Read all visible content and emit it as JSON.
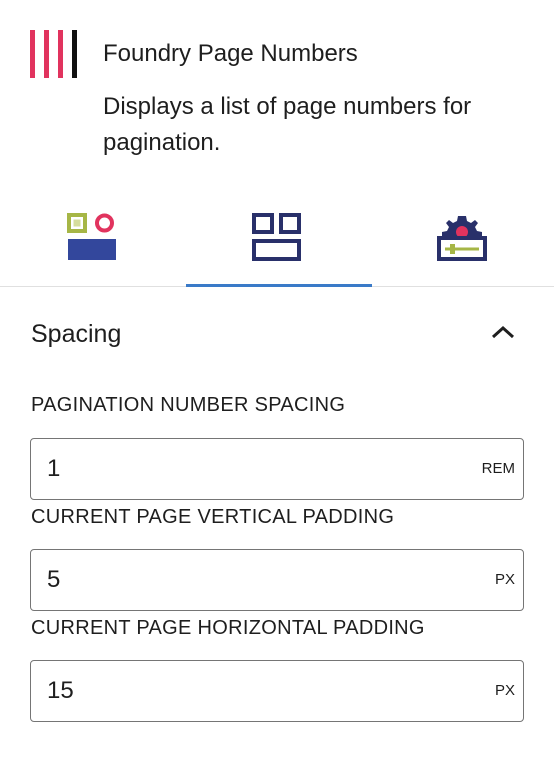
{
  "block": {
    "title": "Foundry Page Numbers",
    "description": "Displays a list of page numbers for pagination.",
    "icon": "pagination-bars-icon",
    "icon_colors": [
      "#e1335e",
      "#e1335e",
      "#e1335e",
      "#111111"
    ]
  },
  "tabs": [
    {
      "name": "styles",
      "icon": "styles-icon",
      "active": false
    },
    {
      "name": "layout",
      "icon": "layout-grid-icon",
      "active": true
    },
    {
      "name": "advanced",
      "icon": "settings-gear-icon",
      "active": false
    }
  ],
  "colors": {
    "accent": "#3a7ac8",
    "navy": "#29306a",
    "blue": "#33479c",
    "olive": "#a6b646",
    "pink": "#e1335e"
  },
  "panel": {
    "title": "Spacing",
    "expanded": true
  },
  "fields": [
    {
      "label": "Pagination Number Spacing",
      "value": "1",
      "unit": "REM"
    },
    {
      "label": "Current Page Vertical Padding",
      "value": "5",
      "unit": "PX"
    },
    {
      "label": "Current Page Horizontal Padding",
      "value": "15",
      "unit": "PX"
    }
  ]
}
